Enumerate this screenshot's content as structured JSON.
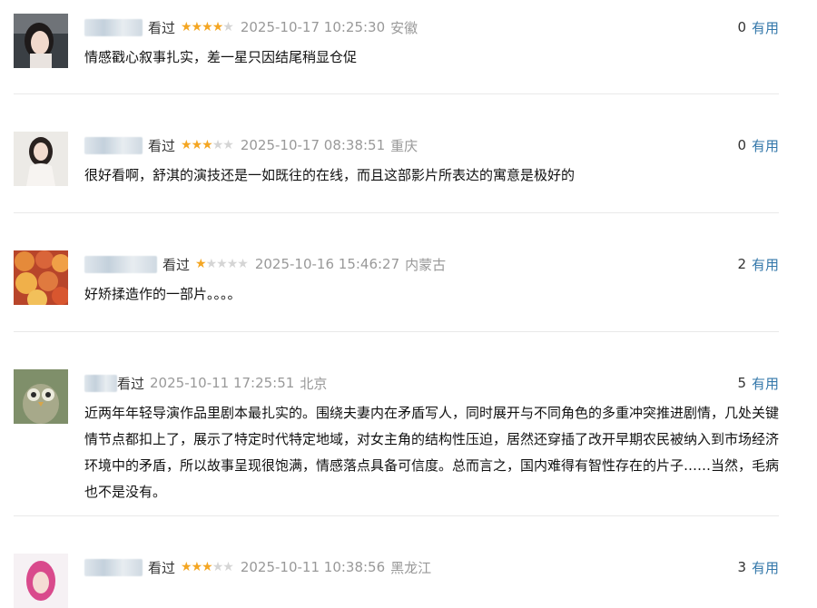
{
  "colors": {
    "star_on": "#f4a623",
    "star_off": "#d5d5d5",
    "link": "#3377aa",
    "muted": "#999999"
  },
  "reviews": [
    {
      "status": "看过",
      "rating": 4,
      "time": "2025-10-17 10:25:30",
      "location": "安徽",
      "useful_count": "0",
      "useful_label": "有用",
      "text": "情感戳心叙事扎实，差一星只因结尾稍显仓促"
    },
    {
      "status": "看过",
      "rating": 3,
      "time": "2025-10-17 08:38:51",
      "location": "重庆",
      "useful_count": "0",
      "useful_label": "有用",
      "text": "很好看啊，舒淇的演技还是一如既往的在线，而且这部影片所表达的寓意是极好的"
    },
    {
      "status": "看过",
      "rating": 1,
      "time": "2025-10-16 15:46:27",
      "location": "内蒙古",
      "useful_count": "2",
      "useful_label": "有用",
      "text": "好矫揉造作的一部片。。。。"
    },
    {
      "status": "看过",
      "rating": 0,
      "time": "2025-10-11 17:25:51",
      "location": "北京",
      "useful_count": "5",
      "useful_label": "有用",
      "text": "近两年年轻导演作品里剧本最扎实的。围绕夫妻内在矛盾写人，同时展开与不同角色的多重冲突推进剧情，几处关键情节点都扣上了，展示了特定时代特定地域，对女主角的结构性压迫，居然还穿插了改开早期农民被纳入到市场经济环境中的矛盾，所以故事呈现很饱满，情感落点具备可信度。总而言之，国内难得有智性存在的片子……当然，毛病也不是没有。"
    },
    {
      "status": "看过",
      "rating": 3,
      "time": "2025-10-11 10:38:56",
      "location": "黑龙江",
      "useful_count": "3",
      "useful_label": "有用",
      "text": ""
    }
  ]
}
